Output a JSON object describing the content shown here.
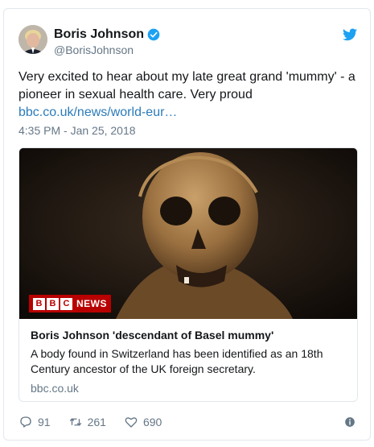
{
  "author": {
    "name": "Boris Johnson",
    "handle": "@BorisJohnson",
    "verified_icon": "verified-badge-icon",
    "platform_icon": "twitter-bird-icon"
  },
  "tweet": {
    "text_lines": [
      "Very excited to hear about my late great grand 'mummy' - a",
      "pioneer in sexual health care. Very proud"
    ],
    "link": "bbc.co.uk/news/world-eur…",
    "timestamp": "4:35 PM - Jan 25, 2018"
  },
  "card": {
    "badge_letters": [
      "B",
      "B",
      "C"
    ],
    "badge_text": "NEWS",
    "title": "Boris Johnson 'descendant of Basel mummy'",
    "description_lines": [
      "A body found in Switzerland has been identified as an 18th",
      "Century ancestor of the UK foreign secretary."
    ],
    "domain": "bbc.co.uk"
  },
  "actions": {
    "replies": "91",
    "retweets": "261",
    "likes": "690"
  },
  "colors": {
    "link": "#2b7bb9",
    "muted": "#657786",
    "twitter_blue": "#1da1f2",
    "bbc_red": "#b80000"
  }
}
